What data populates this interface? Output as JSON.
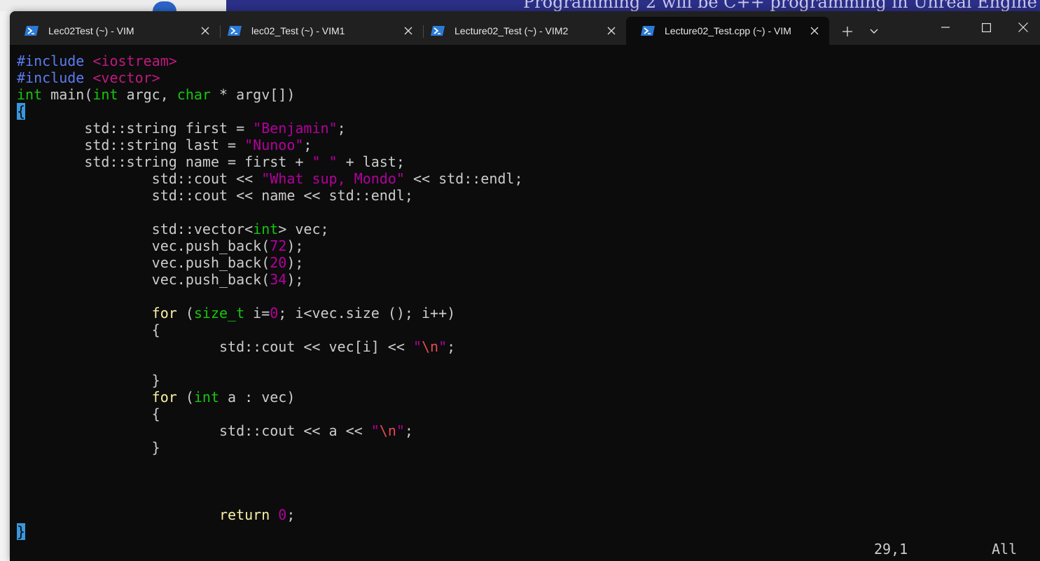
{
  "background": {
    "banner_text": "Programming 2 will  be C++ programming in Unreal Engine"
  },
  "tabs": [
    {
      "label": "Lec02Test (~) - VIM",
      "active": false
    },
    {
      "label": "lec02_Test (~) - VIM1",
      "active": false
    },
    {
      "label": "Lecture02_Test (~) - VIM2",
      "active": false
    },
    {
      "label": "Lecture02_Test.cpp (~) - VIM",
      "active": true
    }
  ],
  "icons": {
    "tab": "powershell-icon",
    "close": "close-icon",
    "new_tab": "plus-icon",
    "dropdown": "chevron-down-icon",
    "minimize": "minimize-icon",
    "maximize": "maximize-icon",
    "window_close": "window-close-icon"
  },
  "colors": {
    "preprocessor": "#5b7cf2",
    "include_path": "#c0197f",
    "type": "#16c60c",
    "keyword": "#f9f1a5",
    "string": "#b4009e",
    "escape": "#e74856",
    "cursor": "#3a96dd"
  },
  "editor": {
    "lines": [
      [
        {
          "t": "#include ",
          "c": "pp"
        },
        {
          "t": "<iostream>",
          "c": "inc"
        }
      ],
      [
        {
          "t": "#include ",
          "c": "pp"
        },
        {
          "t": "<vector>",
          "c": "inc"
        }
      ],
      [
        {
          "t": "int",
          "c": "ty"
        },
        {
          "t": " main("
        },
        {
          "t": "int",
          "c": "ty"
        },
        {
          "t": " argc, "
        },
        {
          "t": "char",
          "c": "ty"
        },
        {
          "t": " * argv[])"
        }
      ],
      [
        {
          "t": "{",
          "c": "cursor"
        }
      ],
      [
        {
          "t": "        std::string first = "
        },
        {
          "t": "\"Benjamin\"",
          "c": "str"
        },
        {
          "t": ";"
        }
      ],
      [
        {
          "t": "        std::string last = "
        },
        {
          "t": "\"Nunoo\"",
          "c": "str"
        },
        {
          "t": ";"
        }
      ],
      [
        {
          "t": "        std::string name = first + "
        },
        {
          "t": "\" \"",
          "c": "str"
        },
        {
          "t": " + last;"
        }
      ],
      [
        {
          "t": "                std::cout << "
        },
        {
          "t": "\"What sup, Mondo\"",
          "c": "str"
        },
        {
          "t": " << std::endl;"
        }
      ],
      [
        {
          "t": "                std::cout << name << std::endl;"
        }
      ],
      [],
      [
        {
          "t": "                std::vector<"
        },
        {
          "t": "int",
          "c": "ty"
        },
        {
          "t": "> vec;"
        }
      ],
      [
        {
          "t": "                vec.push_back("
        },
        {
          "t": "72",
          "c": "num"
        },
        {
          "t": ");"
        }
      ],
      [
        {
          "t": "                vec.push_back("
        },
        {
          "t": "20",
          "c": "num"
        },
        {
          "t": ");"
        }
      ],
      [
        {
          "t": "                vec.push_back("
        },
        {
          "t": "34",
          "c": "num"
        },
        {
          "t": ");"
        }
      ],
      [],
      [
        {
          "t": "                "
        },
        {
          "t": "for",
          "c": "kw"
        },
        {
          "t": " ("
        },
        {
          "t": "size_t",
          "c": "ty"
        },
        {
          "t": " i="
        },
        {
          "t": "0",
          "c": "num"
        },
        {
          "t": "; i<vec.size (); i++)"
        }
      ],
      [
        {
          "t": "                {"
        }
      ],
      [
        {
          "t": "                        std::cout << vec[i] << "
        },
        {
          "t": "\"",
          "c": "str"
        },
        {
          "t": "\\n",
          "c": "esc"
        },
        {
          "t": "\"",
          "c": "str"
        },
        {
          "t": ";"
        }
      ],
      [],
      [
        {
          "t": "                }"
        }
      ],
      [
        {
          "t": "                "
        },
        {
          "t": "for",
          "c": "kw"
        },
        {
          "t": " ("
        },
        {
          "t": "int",
          "c": "ty"
        },
        {
          "t": " a : vec)"
        }
      ],
      [
        {
          "t": "                {"
        }
      ],
      [
        {
          "t": "                        std::cout << a << "
        },
        {
          "t": "\"",
          "c": "str"
        },
        {
          "t": "\\n",
          "c": "esc"
        },
        {
          "t": "\"",
          "c": "str"
        },
        {
          "t": ";"
        }
      ],
      [
        {
          "t": "                }"
        }
      ],
      [],
      [],
      [],
      [
        {
          "t": "                        "
        },
        {
          "t": "return",
          "c": "kw"
        },
        {
          "t": " "
        },
        {
          "t": "0",
          "c": "num"
        },
        {
          "t": ";"
        }
      ],
      [
        {
          "t": "}",
          "c": "cursor"
        }
      ]
    ]
  },
  "statusbar": {
    "position": "29,1",
    "scroll": "All"
  }
}
